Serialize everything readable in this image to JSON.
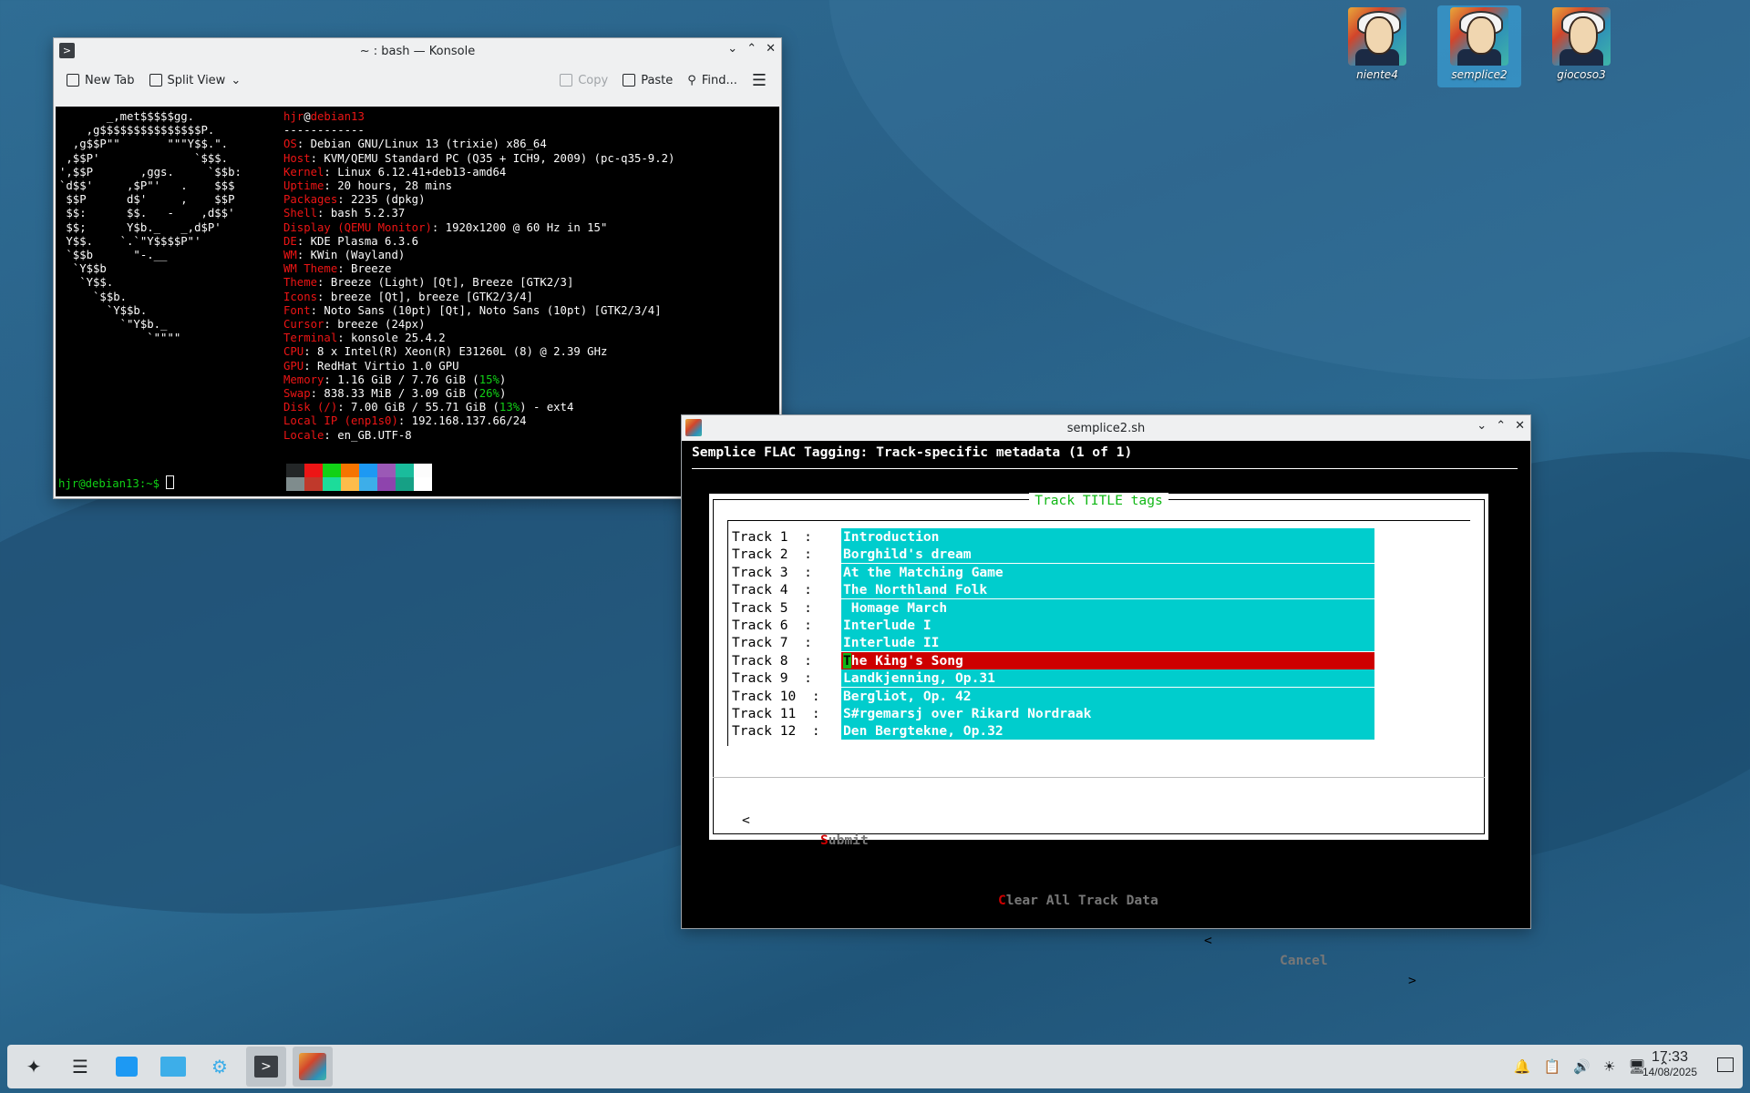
{
  "desktop": {
    "icons": [
      {
        "label": "niente4"
      },
      {
        "label": "semplice2"
      },
      {
        "label": "giocoso3"
      }
    ]
  },
  "konsole": {
    "title": "~ : bash — Konsole",
    "toolbar": {
      "new_tab": "New Tab",
      "split_view": "Split View",
      "copy": "Copy",
      "paste": "Paste",
      "find": "Find..."
    },
    "ascii_logo": [
      "       _,met$$$$$gg.",
      "    ,g$$$$$$$$$$$$$$$P.",
      "  ,g$$P\"\"       \"\"\"Y$$.\".",
      " ,$$P'              `$$$.",
      "',$$P       ,ggs.     `$$b:",
      "`d$$'     ,$P\"'   .    $$$",
      " $$P      d$'     ,    $$P",
      " $$:      $$.   -    ,d$$'",
      " $$;      Y$b._   _,d$P'",
      " Y$$.    `.`\"Y$$$$P\"'",
      " `$$b      \"-.__",
      "  `Y$$b",
      "   `Y$$.",
      "     `$$b.",
      "       `Y$$b.",
      "         `\"Y$b._",
      "             `\"\"\"\""
    ],
    "user": "hjr",
    "host": "debian13",
    "separator": "------------",
    "info": [
      {
        "key": "OS",
        "val": "Debian GNU/Linux 13 (trixie) x86_64"
      },
      {
        "key": "Host",
        "val": "KVM/QEMU Standard PC (Q35 + ICH9, 2009) (pc-q35-9.2)"
      },
      {
        "key": "Kernel",
        "val": "Linux 6.12.41+deb13-amd64"
      },
      {
        "key": "Uptime",
        "val": "20 hours, 28 mins"
      },
      {
        "key": "Packages",
        "val": "2235 (dpkg)"
      },
      {
        "key": "Shell",
        "val": "bash 5.2.37"
      },
      {
        "key": "Display (QEMU Monitor)",
        "val": "1920x1200 @ 60 Hz in 15\""
      },
      {
        "key": "DE",
        "val": "KDE Plasma 6.3.6"
      },
      {
        "key": "WM",
        "val": "KWin (Wayland)"
      },
      {
        "key": "WM Theme",
        "val": "Breeze"
      },
      {
        "key": "Theme",
        "val": "Breeze (Light) [Qt], Breeze [GTK2/3]"
      },
      {
        "key": "Icons",
        "val": "breeze [Qt], breeze [GTK2/3/4]"
      },
      {
        "key": "Font",
        "val": "Noto Sans (10pt) [Qt], Noto Sans (10pt) [GTK2/3/4]"
      },
      {
        "key": "Cursor",
        "val": "breeze (24px)"
      },
      {
        "key": "Terminal",
        "val": "konsole 25.4.2"
      },
      {
        "key": "CPU",
        "val": "8 x Intel(R) Xeon(R) E31260L (8) @ 2.39 GHz"
      },
      {
        "key": "GPU",
        "val": "RedHat Virtio 1.0 GPU"
      }
    ],
    "memory": {
      "key": "Memory",
      "pre": "1.16 GiB / 7.76 GiB (",
      "pct": "15%",
      "post": ")"
    },
    "swap": {
      "key": "Swap",
      "pre": "838.33 MiB / 3.09 GiB (",
      "pct": "26%",
      "post": ")"
    },
    "disk": {
      "key": "Disk (/)",
      "pre": "7.00 GiB / 55.71 GiB (",
      "pct": "13%",
      "post": ") - ext4"
    },
    "local_ip": {
      "key": "Local IP (enp1s0)",
      "val": "192.168.137.66/24"
    },
    "locale": {
      "key": "Locale",
      "val": "en_GB.UTF-8"
    },
    "palette_top": [
      "#232627",
      "#ed1515",
      "#11d116",
      "#f67400",
      "#1d99f3",
      "#9b59b6",
      "#1abc9c",
      "#fcfcfc"
    ],
    "palette_bottom": [
      "#7f8c8d",
      "#c0392b",
      "#1cdc9a",
      "#fdbc4b",
      "#3daee9",
      "#8e44ad",
      "#16a085",
      "#ffffff"
    ],
    "prompt": "hjr@debian13:~$ "
  },
  "semplice": {
    "title": "semplice2.sh",
    "header": "Semplice FLAC Tagging: Track-specific metadata (1 of 1)",
    "dialog_title": "Track TITLE tags",
    "tracks": [
      {
        "label": "Track 1  :",
        "value": "Introduction"
      },
      {
        "label": "Track 2  :",
        "value": "Borghild's dream"
      },
      {
        "label": "Track 3  :",
        "value": "At the Matching Game"
      },
      {
        "label": "Track 4  :",
        "value": "The Northland Folk"
      },
      {
        "label": "Track 5  :",
        "value": " Homage March"
      },
      {
        "label": "Track 6  :",
        "value": "Interlude I"
      },
      {
        "label": "Track 7  :",
        "value": "Interlude II"
      },
      {
        "label": "Track 8  :",
        "value": "The King's Song"
      },
      {
        "label": "Track 9  :",
        "value": "Landkjenning, Op.31"
      },
      {
        "label": "Track 10  :",
        "value": "Bergliot, Op. 42"
      },
      {
        "label": "Track 11  :",
        "value": "S#rgemarsj over Rikard Nordraak"
      },
      {
        "label": "Track 12  :",
        "value": "Den Bergtekne, Op.32"
      }
    ],
    "selected_index": 7,
    "buttons": {
      "submit_hot": "S",
      "submit_rest": "ubmit",
      "clear_hot": "C",
      "clear_rest": "lear All Track Data",
      "cancel": "Cancel",
      "lt": "<",
      "gt": ">"
    }
  },
  "taskbar": {
    "time": "17:33",
    "date": "14/08/2025"
  }
}
